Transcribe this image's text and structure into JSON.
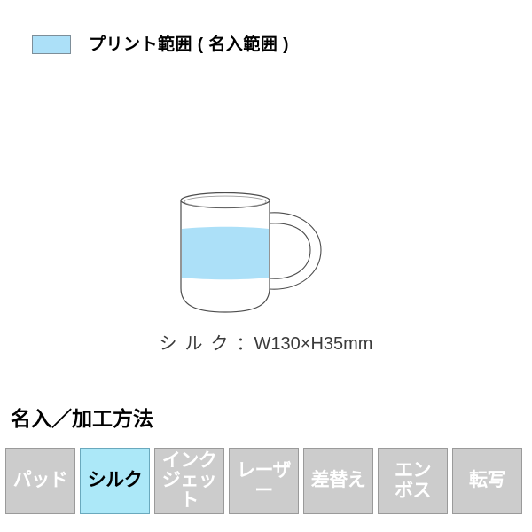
{
  "legend": {
    "swatch_color": "#ace0f8",
    "swatch_border": "#7d8e99",
    "label": "プリント範囲 ( 名入範囲 )"
  },
  "product": {
    "type": "mug",
    "outline_color": "#4d4d4d",
    "print_area_color": "#ace0f8",
    "caption_method": "シルク",
    "caption_separator": "：",
    "caption_dimensions": "W130×H35mm",
    "caption_full": "シ ル ク：W130×H35mm"
  },
  "section": {
    "heading": "名入／加工方法"
  },
  "methods": {
    "inactive_bg": "#cccccc",
    "inactive_text": "#ffffff",
    "active_bg": "#ace8f8",
    "active_text": "#000000",
    "items": [
      {
        "label": "パッド",
        "active": false
      },
      {
        "label": "シルク",
        "active": true
      },
      {
        "label": "インク\nジェット",
        "active": false
      },
      {
        "label": "レーザー",
        "active": false
      },
      {
        "label": "差替え",
        "active": false
      },
      {
        "label": "エン\nボス",
        "active": false
      },
      {
        "label": "転写",
        "active": false
      }
    ]
  }
}
